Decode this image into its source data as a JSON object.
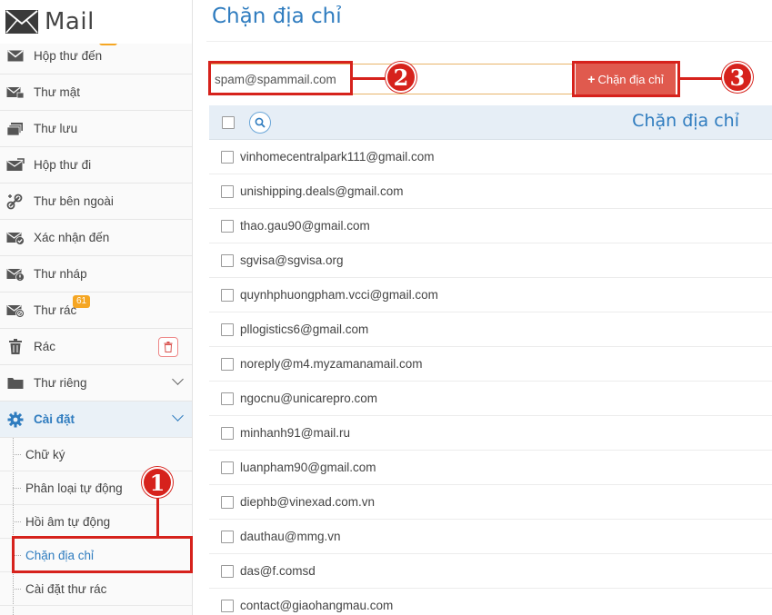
{
  "app": {
    "title": "Mail"
  },
  "sidebar": {
    "items": [
      {
        "name": "inbox",
        "label": "Hộp thư đến",
        "badge": ""
      },
      {
        "name": "secret",
        "label": "Thư mật"
      },
      {
        "name": "archive",
        "label": "Thư lưu"
      },
      {
        "name": "outbox",
        "label": "Hộp thư đi"
      },
      {
        "name": "external",
        "label": "Thư bên ngoài"
      },
      {
        "name": "confirm",
        "label": "Xác nhận đến"
      },
      {
        "name": "drafts",
        "label": "Thư nháp"
      },
      {
        "name": "spam",
        "label": "Thư rác",
        "badge": "61"
      },
      {
        "name": "trash",
        "label": "Rác"
      },
      {
        "name": "private",
        "label": "Thư riêng"
      },
      {
        "name": "settings",
        "label": "Cài đặt"
      }
    ],
    "submenu": [
      {
        "label": "Chữ ký"
      },
      {
        "label": "Phân loại tự động"
      },
      {
        "label": "Hồi âm tự động"
      },
      {
        "label": "Chặn địa chỉ"
      },
      {
        "label": "Cài đặt thư rác"
      }
    ]
  },
  "main": {
    "title": "Chặn địa chỉ",
    "input_value": "spam@spammail.com",
    "block_button": "Chặn địa chỉ",
    "column_header": "Chặn địa chỉ",
    "blocked": [
      "vinhomecentralpark111@gmail.com",
      "unishipping.deals@gmail.com",
      "thao.gau90@gmail.com",
      "sgvisa@sgvisa.org",
      "quynhphuongpham.vcci@gmail.com",
      "pllogistics6@gmail.com",
      "noreply@m4.myzamanamail.com",
      "ngocnu@unicarepro.com",
      "minhanh91@mail.ru",
      "luanpham90@gmail.com",
      "diephb@vinexad.com.vn",
      "dauthau@mmg.vn",
      "das@f.comsd",
      "contact@giaohangmau.com"
    ]
  },
  "annotations": {
    "m1": "1",
    "m2": "2",
    "m3": "3"
  },
  "colors": {
    "accent": "#2f7cbf",
    "danger": "#d6221c",
    "button": "#e05a4e",
    "badge": "#f5a623"
  }
}
